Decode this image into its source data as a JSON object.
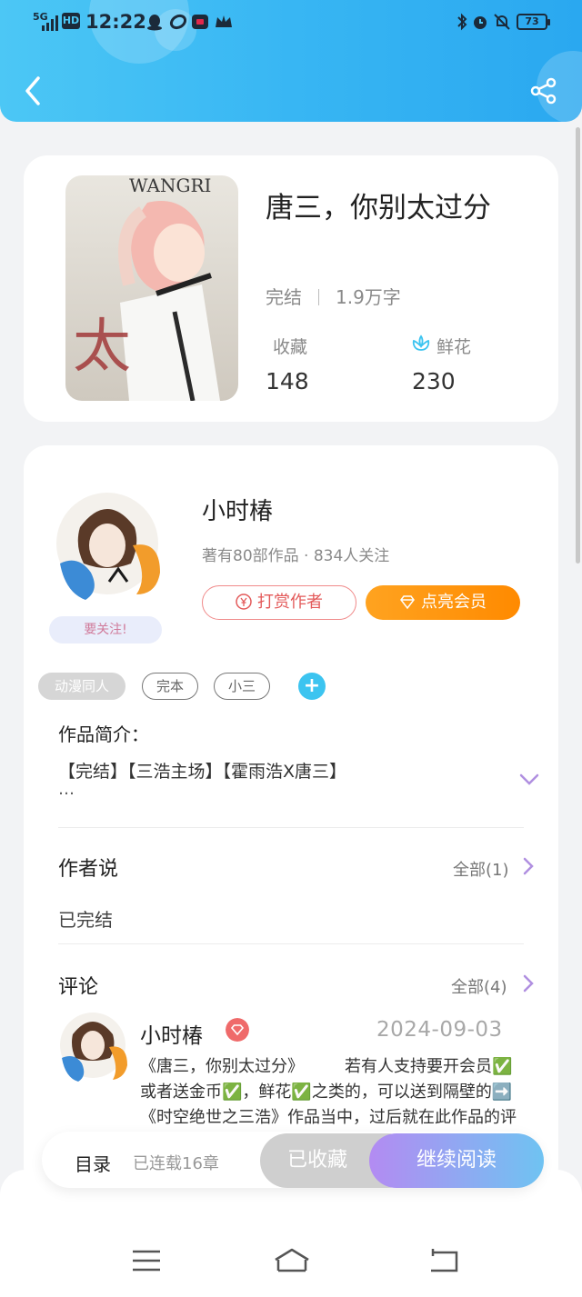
{
  "status_bar": {
    "network": "5G",
    "hd": "HD",
    "time": "12:22",
    "battery": "73"
  },
  "book": {
    "title": "唐三，你别太过分",
    "status": "完结",
    "word_count": "1.9万字",
    "favorites_label": "收藏",
    "favorites_value": "148",
    "flowers_label": "鲜花",
    "flowers_value": "230",
    "cover_text": "WANGRI"
  },
  "author": {
    "name": "小时椿",
    "meta": "著有80部作品 · 834人关注",
    "follow_tag": "要关注!",
    "tip_button": "打赏作者",
    "vip_button": "点亮会员"
  },
  "tags": [
    "动漫同人",
    "完本",
    "小三"
  ],
  "intro": {
    "heading": "作品简介：",
    "text": "【完结】【三浩主场】【霍雨浩X唐三】",
    "ellipsis": "…"
  },
  "author_says": {
    "heading": "作者说",
    "more": "全部(1)",
    "text": "已完结"
  },
  "comments": {
    "heading": "评论",
    "more": "全部(4)",
    "items": [
      {
        "name": "小时椿",
        "date": "2024-09-03",
        "text": "《唐三，你别太过分》　　　若有人支持要开会员✅或者送金币✅，鲜花✅之类的，可以送到隔壁的➡️《时空绝世之三浩》作品当中，过后就在此作品的评论下方说来意，本"
      }
    ]
  },
  "bottom": {
    "toc": "目录",
    "toc_sub": "已连载16章",
    "collected": "已收藏",
    "read": "继续阅读"
  }
}
